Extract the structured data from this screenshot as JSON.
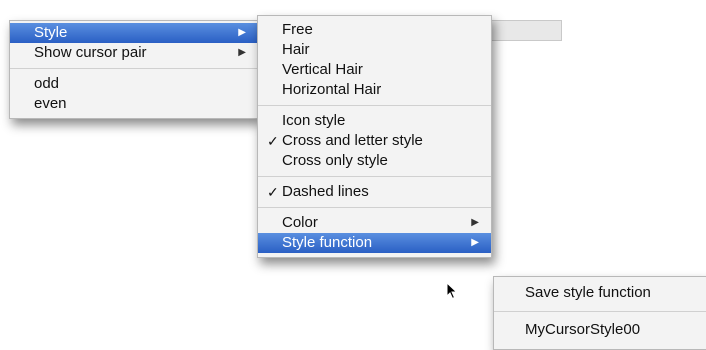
{
  "menu1": {
    "items": [
      {
        "label": "Style",
        "submenu": true,
        "highlighted": true
      },
      {
        "label": "Show cursor pair",
        "submenu": true
      },
      {
        "label": "odd"
      },
      {
        "label": "even"
      }
    ]
  },
  "menu2": {
    "items": [
      {
        "label": "Free"
      },
      {
        "label": "Hair"
      },
      {
        "label": "Vertical Hair"
      },
      {
        "label": "Horizontal Hair"
      },
      {
        "label": "Icon style"
      },
      {
        "label": "Cross and letter style",
        "checked": true
      },
      {
        "label": "Cross only style"
      },
      {
        "label": "Dashed lines",
        "checked": true
      },
      {
        "label": "Color",
        "submenu": true
      },
      {
        "label": "Style function",
        "submenu": true,
        "highlighted": true
      }
    ]
  },
  "menu3": {
    "items": [
      {
        "label": "Save style function"
      },
      {
        "label": "MyCursorStyle00"
      }
    ]
  },
  "glyphs": {
    "check": "✓",
    "submenu_arrow": "▶"
  },
  "colors": {
    "highlight": "#2f66c9",
    "menu_bg": "#f3f3f3"
  }
}
